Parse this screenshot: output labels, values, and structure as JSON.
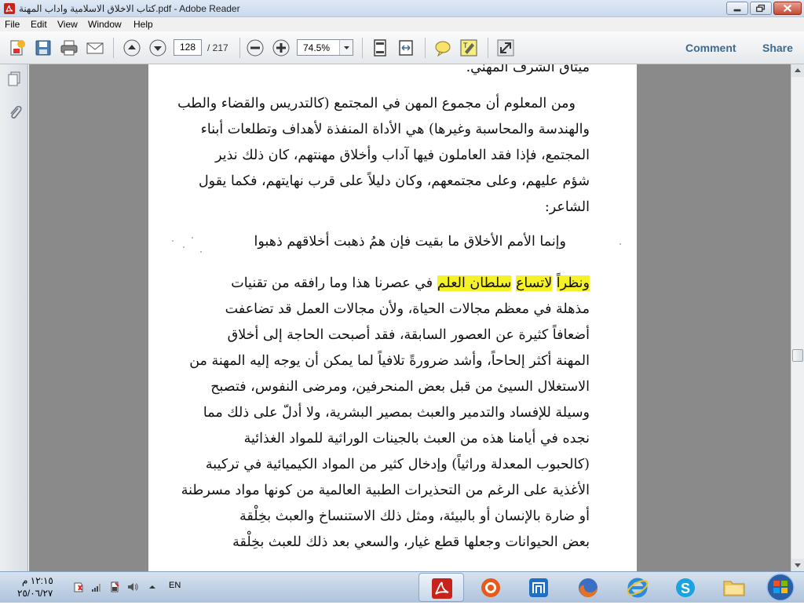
{
  "window": {
    "title": "كتاب الاخلاق الاسلامية واداب المهنة.pdf - Adobe Reader"
  },
  "menu": [
    "File",
    "Edit",
    "View",
    "Window",
    "Help"
  ],
  "toolbar": {
    "page_current": "128",
    "page_total": "/ 217",
    "zoom": "74.5%",
    "comment_label": "Comment",
    "share_label": "Share"
  },
  "document": {
    "lines": [
      "ميثاق الشرف المهني.",
      "ومن المعلوم أن مجموع المهن في المجتمع (كالتدريس والقضاء والطب",
      "والهندسة والمحاسبة وغيرها) هي الأداة المنفذة لأهداف وتطلعات أبناء",
      "المجتمع، فإذا فقد العاملون فيها آداب وأخلاق مهنتهم، كان ذلك نذير",
      "شؤم عليهم، وعلى مجتمعهم، وكان دليلاً على قرب نهايتهم، فكما يقول",
      "الشاعر:",
      "وإنما الأمم الأخلاق ما بقيت      فإن همُ ذهبت أخلاقهم ذهبوا",
      "في عصرنا هذا وما رافقه من تقنيات",
      "مذهلة في معظم مجالات الحياة، ولأن مجالات العمل قد تضاعفت",
      "أضعافاً كثيرة عن العصور السابقة، فقد أصبحت الحاجة إلى أخلاق",
      "المهنة أكثر إلحاحاً، وأشد ضرورةً تلافياً لما يمكن أن يوجه إليه المهنة من",
      "الاستغلال السيئ من قبل بعض المنحرفين، ومرضى النفوس، فتصبح",
      "وسيلة للإفساد والتدمير والعبث بمصير البشرية، ولا أدلّ على ذلك مما",
      "نجده في أيامنا هذه من العبث بالجينات الوراثية للمواد الغذائية",
      "(كالحبوب المعدلة وراثياً) وإدخال كثير من المواد الكيميائية في تركيبة",
      "الأغذية على الرغم من التحذيرات الطبية العالمية من كونها مواد مسرطنة",
      "أو ضارة بالإنسان أو بالبيئة، ومثل ذلك الاستنساخ والعبث بخِلْقة",
      "بعض الحيوانات وجعلها قطع غيار، والسعي بعد ذلك للعبث بخِلْقة"
    ],
    "highlight_words": [
      "ونظراً",
      "لاتساع",
      "سلطان العلم"
    ]
  },
  "taskbar": {
    "clock_time": "١٢:١٥ م",
    "clock_date": "٢٥/٠٦/٢٧",
    "language": "EN"
  },
  "colors": {
    "highlight": "#f6f228",
    "toolbar_link": "#3b6a93",
    "doc_background": "#8a8a8a"
  },
  "icons": [
    "adobe-reader-icon",
    "create-icon",
    "save-icon",
    "print-icon",
    "email-icon",
    "page-up-icon",
    "page-down-icon",
    "zoom-out-icon",
    "zoom-in-icon",
    "fit-page-icon",
    "fit-width-icon",
    "sticky-note-icon",
    "highlight-icon",
    "expand-icon",
    "pages-panel-icon",
    "attachments-icon",
    "windows-start-icon"
  ]
}
